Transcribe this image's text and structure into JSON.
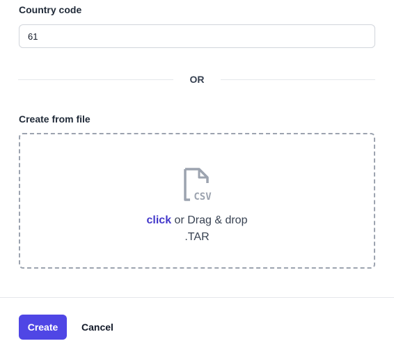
{
  "form": {
    "country_code_label": "Country code",
    "country_code_value": "61",
    "divider_text": "OR",
    "file_label": "Create from file"
  },
  "dropzone": {
    "icon": "csv-file-icon",
    "click_text": "click",
    "drag_text": " or Drag & drop",
    "accepted_types": ".TAR",
    "icon_label": "CSV"
  },
  "footer": {
    "create_label": "Create",
    "cancel_label": "Cancel"
  },
  "colors": {
    "accent": "#4f46e5",
    "link": "#4338ca",
    "border": "#d1d5db",
    "dashed_border": "#9ca3af",
    "icon_gray": "#9ca3af"
  }
}
